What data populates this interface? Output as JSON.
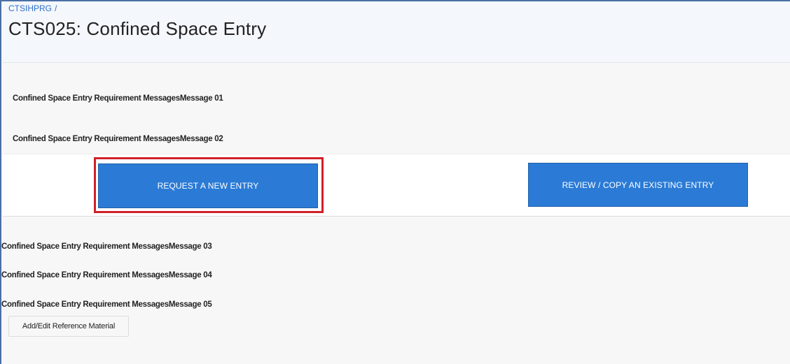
{
  "breadcrumb": {
    "root": "CTSIHPRG",
    "separator": "/"
  },
  "page": {
    "title": "CTS025: Confined Space Entry"
  },
  "messages": [
    "Confined Space Entry Requirement MessagesMessage 01",
    "Confined Space Entry Requirement MessagesMessage 02",
    "Confined Space Entry Requirement MessagesMessage 03",
    "Confined Space Entry Requirement MessagesMessage 04",
    "Confined Space Entry Requirement MessagesMessage 05"
  ],
  "actions": {
    "request_new_label": "REQUEST A NEW ENTRY",
    "review_copy_label": "REVIEW / COPY AN EXISTING ENTRY",
    "reference_material_label": "Add/Edit Reference Material"
  },
  "colors": {
    "primary_button": "#2b7bd6",
    "highlight_outline": "#d0202a",
    "link": "#3070c8"
  }
}
